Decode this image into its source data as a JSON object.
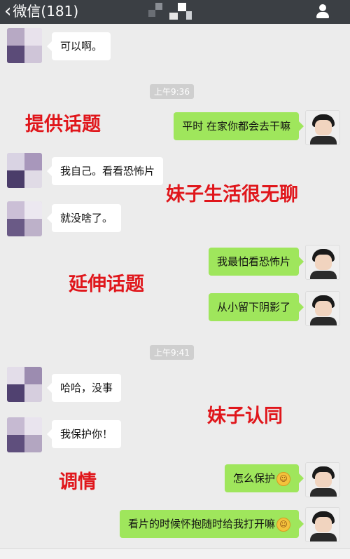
{
  "header": {
    "back_label": "微信(181)",
    "back_icon": "chevron-left-icon",
    "profile_icon": "person-icon"
  },
  "timestamps": [
    "上午9:36",
    "上午9:41"
  ],
  "messages": [
    {
      "side": "left",
      "text": "可以啊。"
    },
    {
      "side": "right",
      "text": "平时 在家你都会去干嘛"
    },
    {
      "side": "left",
      "text": "我自己。看看恐怖片"
    },
    {
      "side": "left",
      "text": "就没啥了。"
    },
    {
      "side": "right",
      "text": "我最怕看恐怖片"
    },
    {
      "side": "right",
      "text": "从小留下阴影了"
    },
    {
      "side": "left",
      "text": "哈哈，没事"
    },
    {
      "side": "left",
      "text": "我保护你！"
    },
    {
      "side": "right",
      "text": "怎么保护",
      "emoji": "☺"
    },
    {
      "side": "right",
      "text": "看片的时候怀抱随时给我打开嘛",
      "emoji": "☺"
    }
  ],
  "annotations": [
    "提供话题",
    "妹子生活很无聊",
    "延伸话题",
    "妹子认同",
    "调情"
  ],
  "colors": {
    "topbar": "#3b3f44",
    "background": "#ececec",
    "bubble_sent": "#9fe65c",
    "bubble_received": "#ffffff",
    "annotation": "#e0161b"
  }
}
